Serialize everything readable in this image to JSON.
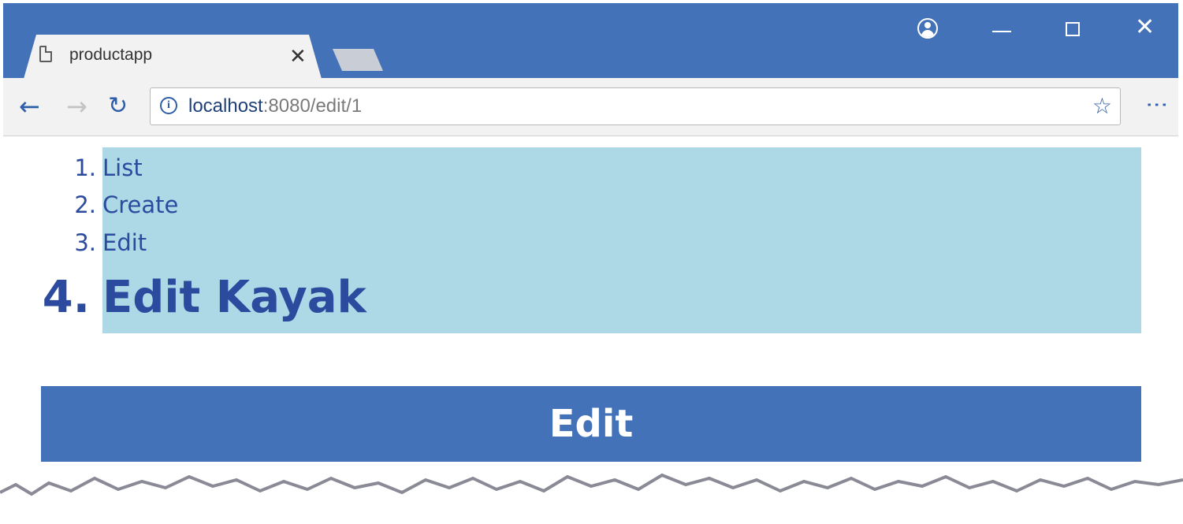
{
  "browser": {
    "tab_title": "productapp",
    "tab_close": "✕",
    "url_host": "localhost",
    "url_path": ":8080/edit/1"
  },
  "toolbar": {
    "back": "←",
    "forward": "→",
    "reload": "↻",
    "star": "☆",
    "menu": "⋮"
  },
  "window_controls": {
    "close": "✕"
  },
  "page": {
    "list": [
      {
        "num": "1.",
        "label": "List"
      },
      {
        "num": "2.",
        "label": "Create"
      },
      {
        "num": "3.",
        "label": "Edit"
      }
    ],
    "heading_num": "4.",
    "heading": "Edit Kayak",
    "banner": "Edit"
  },
  "colors": {
    "chrome_blue": "#4472B8",
    "highlight": "#ADD8E6",
    "text_blue": "#2c4a9e"
  },
  "icons": [
    "document-icon",
    "close-icon",
    "profile-icon",
    "minimize-icon",
    "maximize-icon",
    "back-icon",
    "forward-icon",
    "reload-icon",
    "info-icon",
    "star-icon",
    "menu-icon"
  ]
}
